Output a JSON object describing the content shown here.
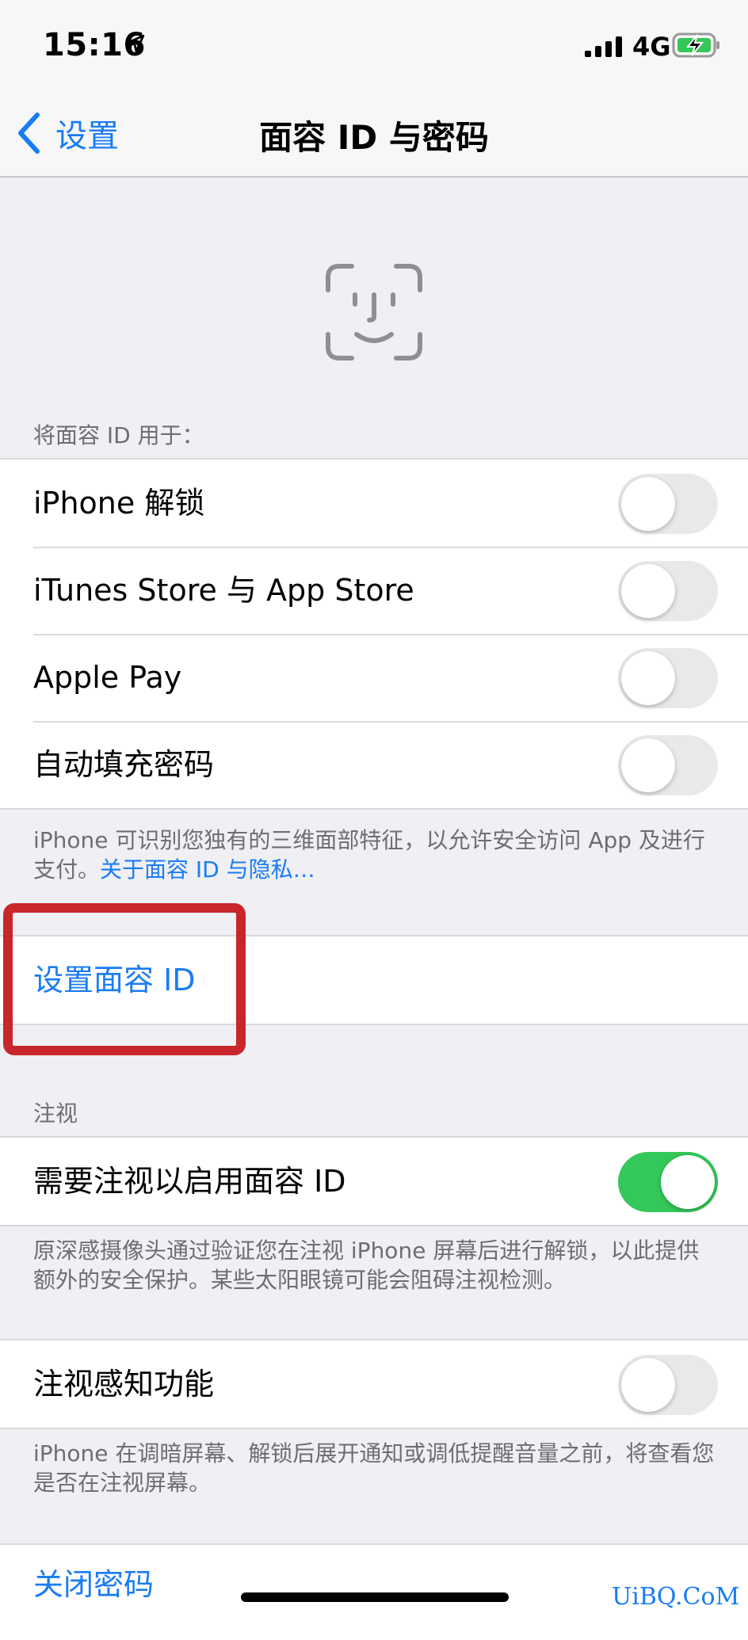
{
  "status_bar": {
    "time": "15:16",
    "network": "4G",
    "icons": [
      "location-arrow-icon",
      "cellular-signal-icon",
      "battery-charging-icon"
    ]
  },
  "nav": {
    "back_label": "设置",
    "title": "面容 ID 与密码"
  },
  "hero_icon": "face-id-icon",
  "use_face_id": {
    "header": "将面容 ID 用于：",
    "items": [
      {
        "label": "iPhone 解锁",
        "on": false
      },
      {
        "label": "iTunes Store 与 App Store",
        "on": false
      },
      {
        "label": "Apple Pay",
        "on": false
      },
      {
        "label": "自动填充密码",
        "on": false
      }
    ],
    "footer_text": "iPhone 可识别您独有的三维面部特征，以允许安全访问 App 及进行支付。",
    "footer_link": "关于面容 ID 与隐私…"
  },
  "setup": {
    "label": "设置面容 ID"
  },
  "attention": {
    "header": "注视",
    "item": {
      "label": "需要注视以启用面容 ID",
      "on": true
    },
    "footer": "原深感摄像头通过验证您在注视 iPhone 屏幕后进行解锁，以此提供额外的安全保护。某些太阳眼镜可能会阻碍注视检测。"
  },
  "attention_aware": {
    "item": {
      "label": "注视感知功能",
      "on": false
    },
    "footer": "iPhone 在调暗屏幕、解锁后展开通知或调低提醒音量之前，将查看您是否在注视屏幕。"
  },
  "passcode": {
    "label": "关闭密码"
  },
  "watermark": "UiBQ.CoM",
  "colors": {
    "accent": "#1a7cf5",
    "toggle_on": "#34c759",
    "annotation": "#c9262b"
  }
}
